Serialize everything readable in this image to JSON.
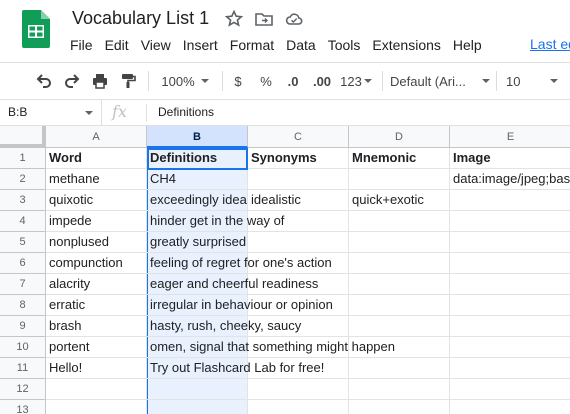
{
  "doc": {
    "title": "Vocabulary List 1",
    "last_edit": "Last ed"
  },
  "menu": [
    "File",
    "Edit",
    "View",
    "Insert",
    "Format",
    "Data",
    "Tools",
    "Extensions",
    "Help"
  ],
  "toolbar": {
    "zoom": "100%",
    "currency": "$",
    "percent": "%",
    "dec_decrease": ".0",
    "dec_increase": ".00",
    "more_formats": "123",
    "font": "Default (Ari...",
    "font_size": "10"
  },
  "formula_bar": {
    "name_box": "B:B",
    "fx": "fx",
    "value": "Definitions"
  },
  "columns": [
    "A",
    "B",
    "C",
    "D",
    "E"
  ],
  "rows": [
    {
      "n": "1",
      "A": "Word",
      "B": "Definitions",
      "C": "Synonyms",
      "D": "Mnemonic",
      "E": "Image"
    },
    {
      "n": "2",
      "A": "methane",
      "B": "CH4",
      "C": "",
      "D": "",
      "E": "data:image/jpeg;bas"
    },
    {
      "n": "3",
      "A": "quixotic",
      "B": "exceedingly idea",
      "C": "idealistic",
      "D": "quick+exotic",
      "E": ""
    },
    {
      "n": "4",
      "A": "impede",
      "B": "hinder get in the way of",
      "C": "",
      "D": "",
      "E": ""
    },
    {
      "n": "5",
      "A": "nonplused",
      "B": "greatly surprised",
      "C": "",
      "D": "",
      "E": ""
    },
    {
      "n": "6",
      "A": "compunction",
      "B": "feeling of regret for one's action",
      "C": "",
      "D": "",
      "E": ""
    },
    {
      "n": "7",
      "A": "alacrity",
      "B": "eager and cheerful readiness",
      "C": "",
      "D": "",
      "E": ""
    },
    {
      "n": "8",
      "A": "erratic",
      "B": "irregular in behaviour or opinion",
      "C": "",
      "D": "",
      "E": ""
    },
    {
      "n": "9",
      "A": "brash",
      "B": "hasty, rush, cheeky, saucy",
      "C": "",
      "D": "",
      "E": ""
    },
    {
      "n": "10",
      "A": "portent",
      "B": "omen, signal that something might happen",
      "C": "",
      "D": "",
      "E": ""
    },
    {
      "n": "11",
      "A": "Hello!",
      "B": "Try out Flashcard Lab for free!",
      "C": "",
      "D": "",
      "E": ""
    },
    {
      "n": "12",
      "A": "",
      "B": "",
      "C": "",
      "D": "",
      "E": ""
    },
    {
      "n": "13",
      "A": "",
      "B": "",
      "C": "",
      "D": "",
      "E": ""
    }
  ],
  "colors": {
    "accent": "#1a73e8",
    "sheets_green": "#0f9d58"
  },
  "icons": [
    "sheets-logo-icon",
    "star-icon",
    "move-folder-icon",
    "cloud-status-icon",
    "undo-icon",
    "redo-icon",
    "print-icon",
    "paint-format-icon"
  ]
}
